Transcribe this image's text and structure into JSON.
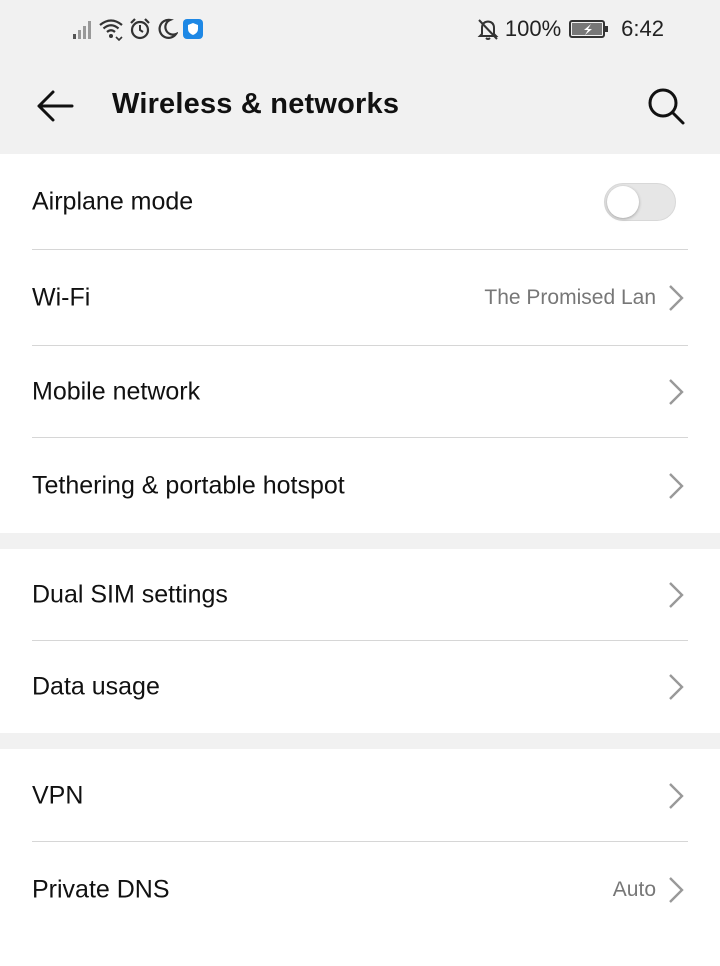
{
  "status_bar": {
    "battery": "100%",
    "time": "6:42"
  },
  "header": {
    "title": "Wireless & networks",
    "back_icon": "arrow-left-icon",
    "search_icon": "search-icon"
  },
  "groups": [
    {
      "items": [
        {
          "label": "Airplane mode",
          "toggle": false
        },
        {
          "label": "Wi-Fi",
          "value": "The Promised Lan"
        },
        {
          "label": "Mobile network"
        },
        {
          "label": "Tethering & portable hotspot"
        }
      ]
    },
    {
      "items": [
        {
          "label": "Dual SIM settings"
        },
        {
          "label": "Data usage"
        }
      ]
    },
    {
      "items": [
        {
          "label": "VPN"
        },
        {
          "label": "Private DNS",
          "value": "Auto"
        }
      ]
    }
  ],
  "colors": {
    "background": "#f1f1f1",
    "card": "#ffffff",
    "secondary_text": "#777777",
    "notification_icon": "#1e88e5"
  }
}
